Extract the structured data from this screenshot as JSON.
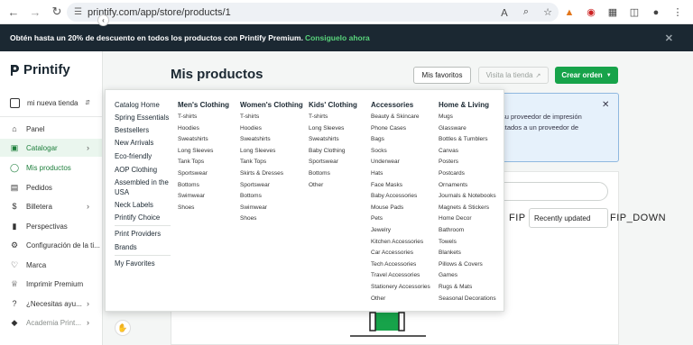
{
  "browser": {
    "url": "printify.com/app/store/products/1"
  },
  "promo": {
    "text": "Obtén hasta un 20% de descuento en todos los productos con Printify Premium.",
    "link": "Consiguelo ahora"
  },
  "sidebar": {
    "brand": "Printify",
    "store_name": "mi nueva tienda",
    "items": [
      {
        "label": "Panel",
        "icon": "home-icon"
      },
      {
        "label": "Catalogar",
        "icon": "catalog-icon"
      },
      {
        "label": "Mis productos",
        "icon": "tag-icon"
      },
      {
        "label": "Pedidos",
        "icon": "orders-icon"
      },
      {
        "label": "Billetera",
        "icon": "dollar-icon"
      },
      {
        "label": "Perspectivas",
        "icon": "chart-icon"
      },
      {
        "label": "Configuración de la ti...",
        "icon": "gear-icon"
      },
      {
        "label": "Marca",
        "icon": "heart-icon"
      },
      {
        "label": "Imprimir Premium",
        "icon": "crown-icon"
      },
      {
        "label": "¿Necesitas ayu...",
        "icon": "help-icon"
      },
      {
        "label": "Academia Print...",
        "icon": "academy-icon"
      }
    ]
  },
  "header": {
    "title": "Mis productos",
    "favorites_button": "Mis favoritos",
    "visit_store_button": "Visita la tienda",
    "create_order_button": "Crear orden"
  },
  "background": {
    "info_line1": "su proveedor de impresión",
    "info_line2": "ctados a un proveedor de",
    "fip_up": "FIP",
    "sort_label": "Recently updated",
    "fip_down": "FIP_DOWN"
  },
  "menu": {
    "left": [
      "Catalog Home",
      "Spring Essentials",
      "Bestsellers",
      "New Arrivals",
      "Eco-friendly",
      "AOP Clothing",
      "Assembled in the",
      "USA",
      "Neck Labels",
      "Printify Choice"
    ],
    "left_bottom": [
      "Print Providers",
      "Brands"
    ],
    "left_last": "My Favorites",
    "columns": [
      {
        "title": "Men's Clothing",
        "items": [
          "T-shirts",
          "Hoodies",
          "Sweatshirts",
          "Long Sleeves",
          "Tank Tops",
          "Sportswear",
          "Bottoms",
          "Swimwear",
          "Shoes"
        ]
      },
      {
        "title": "Women's Clothing",
        "items": [
          "T-shirts",
          "Hoodies",
          "Sweatshirts",
          "Long Sleeves",
          "Tank Tops",
          "Skirts & Dresses",
          "Sportswear",
          "Bottoms",
          "Swimwear",
          "Shoes"
        ]
      },
      {
        "title": "Kids' Clothing",
        "items": [
          "T-shirts",
          "Long Sleeves",
          "Sweatshirts",
          "Baby Clothing",
          "Sportswear",
          "Bottoms",
          "Other"
        ]
      },
      {
        "title": "Accessories",
        "items": [
          "Beauty & Skincare",
          "Phone Cases",
          "Bags",
          "Socks",
          "Underwear",
          "Hats",
          "Face Masks",
          "Baby Accessories",
          "Mouse Pads",
          "Pets",
          "Jewelry",
          "Kitchen Accessories",
          "Car Accessories",
          "Tech Accessories",
          "Travel Accessories",
          "Stationery Accessories",
          "Other"
        ]
      },
      {
        "title": "Home & Living",
        "items": [
          "Mugs",
          "Glassware",
          "Bottles & Tumblers",
          "Canvas",
          "Posters",
          "Postcards",
          "Ornaments",
          "Journals & Notebooks",
          "Magnets & Stickers",
          "Home Decor",
          "Bathroom",
          "Towels",
          "Blankets",
          "Pillows & Covers",
          "Games",
          "Rugs & Mats",
          "Seasonal Decorations"
        ]
      }
    ]
  },
  "colors": {
    "brand_green": "#17a34a",
    "banner_dark": "#1b2832"
  }
}
